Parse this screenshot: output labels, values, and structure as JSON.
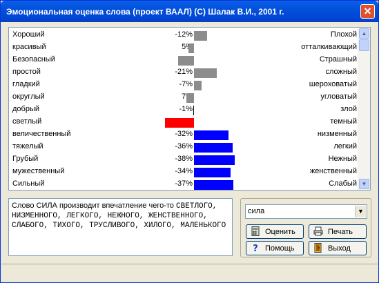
{
  "window": {
    "title": "Эмоциональная оценка слова  (проект ВААЛ)  (С) Шалак В.И., 2001 г.",
    "close_glyph": "✕"
  },
  "colors": {
    "grey_bar": "#8c8c8c",
    "red_bar": "#ff0000",
    "blue_bar": "#0000ff"
  },
  "scales": [
    {
      "left": "Хороший",
      "pct": "-12%",
      "right": "Плохой",
      "value": -12,
      "color": "grey"
    },
    {
      "left": "красивый",
      "pct": "5%",
      "right": "отталкивающий",
      "value": 5,
      "color": "grey"
    },
    {
      "left": "Безопасный",
      "pct": "15%",
      "right": "Страшный",
      "value": 15,
      "color": "grey"
    },
    {
      "left": "простой",
      "pct": "-21%",
      "right": "сложный",
      "value": -21,
      "color": "grey"
    },
    {
      "left": "гладкий",
      "pct": "-7%",
      "right": "шероховатый",
      "value": -7,
      "color": "grey"
    },
    {
      "left": "округлый",
      "pct": "7%",
      "right": "угловатый",
      "value": 7,
      "color": "grey"
    },
    {
      "left": "добрый",
      "pct": "-1%",
      "right": "злой",
      "value": -1,
      "color": "grey"
    },
    {
      "left": "светлый",
      "pct": "27%",
      "right": "темный",
      "value": 27,
      "color": "red"
    },
    {
      "left": "величественный",
      "pct": "-32%",
      "right": "низменный",
      "value": -32,
      "color": "blue"
    },
    {
      "left": "тяжелый",
      "pct": "-36%",
      "right": "легкий",
      "value": -36,
      "color": "blue"
    },
    {
      "left": "Грубый",
      "pct": "-38%",
      "right": "Нежный",
      "value": -38,
      "color": "blue"
    },
    {
      "left": "мужественный",
      "pct": "-34%",
      "right": "женственный",
      "value": -34,
      "color": "blue"
    },
    {
      "left": "Сильный",
      "pct": "-37%",
      "right": "Слабый",
      "value": -37,
      "color": "blue"
    }
  ],
  "scrollbar": {
    "up_glyph": "▲",
    "down_glyph": "▼"
  },
  "result": {
    "lead": "Слово СИЛА производит впечатление чего-то ",
    "words": "СВЕТЛОГО, НИЗМЕННОГО, ЛЕГКОГО, НЕЖНОГО, ЖЕНСТВЕННОГО, СЛАБОГО, ТИХОГО, ТРУСЛИВОГО, ХИЛОГО, МАЛЕНЬКОГО"
  },
  "controls": {
    "word_value": "сила",
    "dropdown_glyph": "▼",
    "evaluate_label": "Оценить",
    "print_label": "Печать",
    "help_label": "Помощь",
    "exit_label": "Выход",
    "evaluate_icon": "calculator-icon",
    "print_icon": "printer-icon",
    "help_icon": "help-icon",
    "exit_icon": "exit-icon"
  }
}
